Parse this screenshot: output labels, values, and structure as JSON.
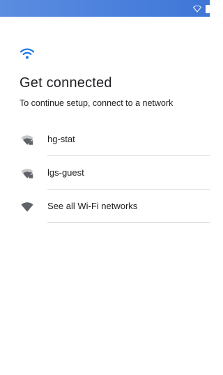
{
  "status_bar": {
    "icons": [
      "wifi-icon",
      "battery-icon"
    ],
    "color": "#4a7fdc"
  },
  "header": {
    "icon": "wifi-icon",
    "accent_color": "#1a73e8",
    "title": "Get connected",
    "subtitle": "To continue setup, connect to a network"
  },
  "networks": [
    {
      "label": "hg-stat",
      "icon": "wifi-locked-icon",
      "secured": true
    },
    {
      "label": "lgs-guest",
      "icon": "wifi-locked-icon",
      "secured": true
    },
    {
      "label": "See all Wi-Fi networks",
      "icon": "wifi-icon",
      "secured": false
    }
  ]
}
